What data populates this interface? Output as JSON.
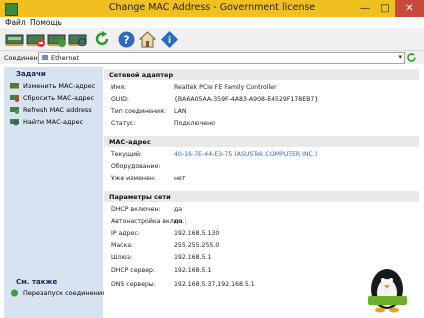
{
  "window": {
    "title": "Change MAC Address - Government license",
    "minimize": "—",
    "maximize": "□",
    "close": "✕"
  },
  "menu": {
    "file": "Файл",
    "help": "Помощь"
  },
  "toolbar": {
    "buttons": [
      "change-mac",
      "reset-mac",
      "refresh-mac",
      "find-mac",
      "refresh",
      "help",
      "home",
      "info"
    ]
  },
  "connection": {
    "label": "Соединение:",
    "value": "Ethernet"
  },
  "sidebar": {
    "tasks_header": "Задачи",
    "tasks": [
      "Изменить MAC-адрес",
      "Сбросить MAC-адрес",
      "Refresh MAC address",
      "Найти MAC-адрес"
    ],
    "see_also_header": "См. также",
    "see_also": [
      "Перезапуск соединения"
    ]
  },
  "adapter": {
    "header": "Сетевой адаптер",
    "rows": [
      {
        "k": "Имя:",
        "v": "Realtek PCIe FE Family Controller"
      },
      {
        "k": "GUID:",
        "v": "{BA6A05AA-359F-4A83-A908-E4529F178EB7}"
      },
      {
        "k": "Тип соединения:",
        "v": "LAN"
      },
      {
        "k": "Статус:",
        "v": "Подключено"
      }
    ]
  },
  "mac": {
    "header": "MAC-адрес",
    "rows": [
      {
        "k": "Текущий:",
        "v": "40-16-7E-44-E3-75 (ASUSTek COMPUTER INC.)"
      },
      {
        "k": "Оборудование:",
        "v": ""
      },
      {
        "k": "Уже изменен:",
        "v": "нет"
      }
    ]
  },
  "network": {
    "header": "Параметры сети",
    "rows": [
      {
        "k": "DHCP включен:",
        "v": "да"
      },
      {
        "k": "Автонастройка включ.:",
        "v": "да"
      },
      {
        "k": "IP адрес:",
        "v": "192.168.5.130"
      },
      {
        "k": "Маска:",
        "v": "255.255.255.0"
      },
      {
        "k": "Шлюз:",
        "v": "192.168.5.1"
      },
      {
        "k": "DHCP сервер:",
        "v": "192.168.5.1"
      },
      {
        "k": "DNS серверы:",
        "v": "192.168.5.37,192.168.5.1"
      }
    ]
  }
}
